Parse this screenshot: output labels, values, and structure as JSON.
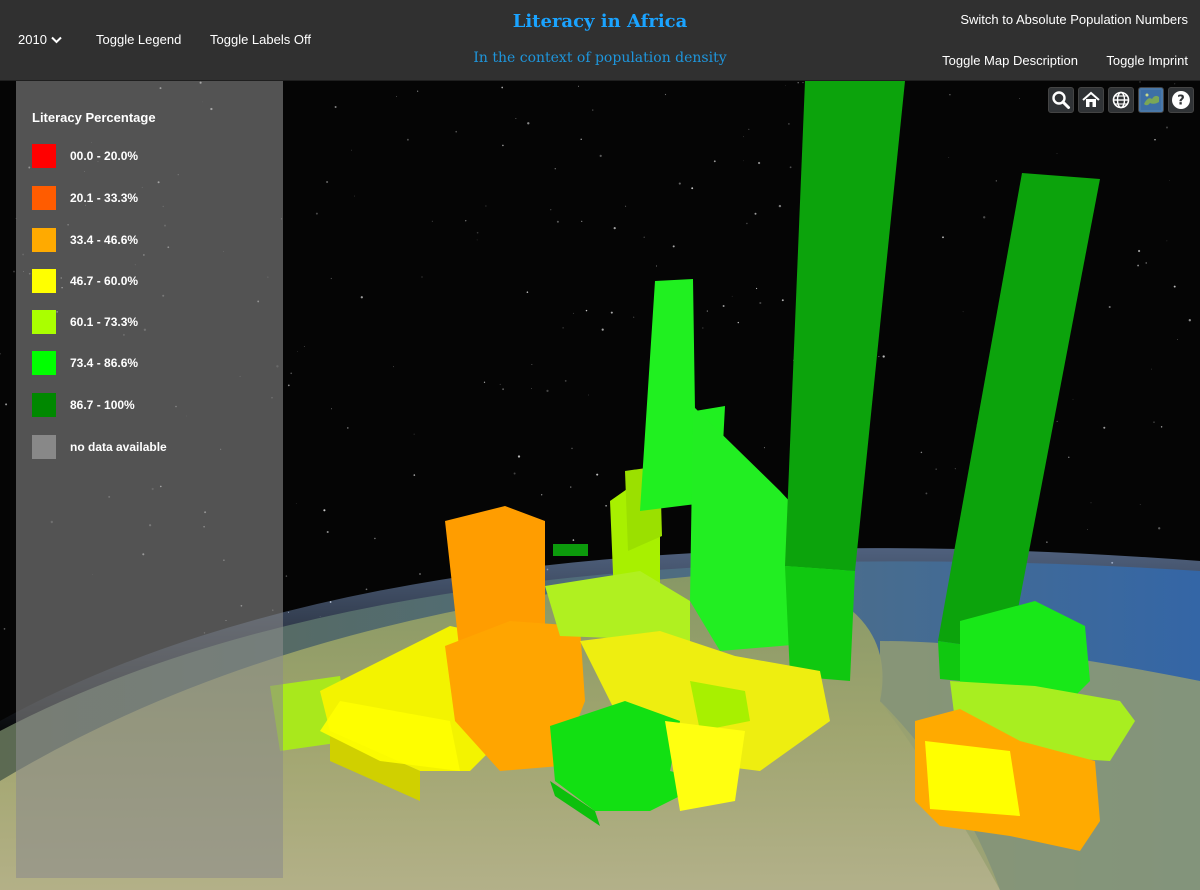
{
  "header": {
    "year": "2010",
    "toggle_legend": "Toggle Legend",
    "toggle_labels": "Toggle Labels Off",
    "title": "Literacy in Africa",
    "subtitle": "In the context of population density",
    "switch_population": "Switch to Absolute Population Numbers",
    "toggle_description": "Toggle Map Description",
    "toggle_imprint": "Toggle Imprint"
  },
  "legend": {
    "title": "Literacy Percentage",
    "items": [
      {
        "label": "00.0 - 20.0%",
        "color": "#ff0000"
      },
      {
        "label": "20.1 - 33.3%",
        "color": "#ff5c00"
      },
      {
        "label": "33.4 - 46.6%",
        "color": "#ffaa00"
      },
      {
        "label": "46.7 - 60.0%",
        "color": "#ffff00"
      },
      {
        "label": "60.1 - 73.3%",
        "color": "#aaff00"
      },
      {
        "label": "73.4 - 86.6%",
        "color": "#00ff00"
      },
      {
        "label": "86.7 - 100%",
        "color": "#008800"
      },
      {
        "label": "no data available",
        "color": "#888888"
      }
    ]
  },
  "toolbar": [
    "search-icon",
    "home-icon",
    "globe-icon",
    "imagery-icon",
    "help-icon"
  ],
  "colors": {
    "accent_title": "#1aa3ff",
    "topbar": "#303030",
    "ocean": "#3a6ea8",
    "land": "#9aa366"
  }
}
